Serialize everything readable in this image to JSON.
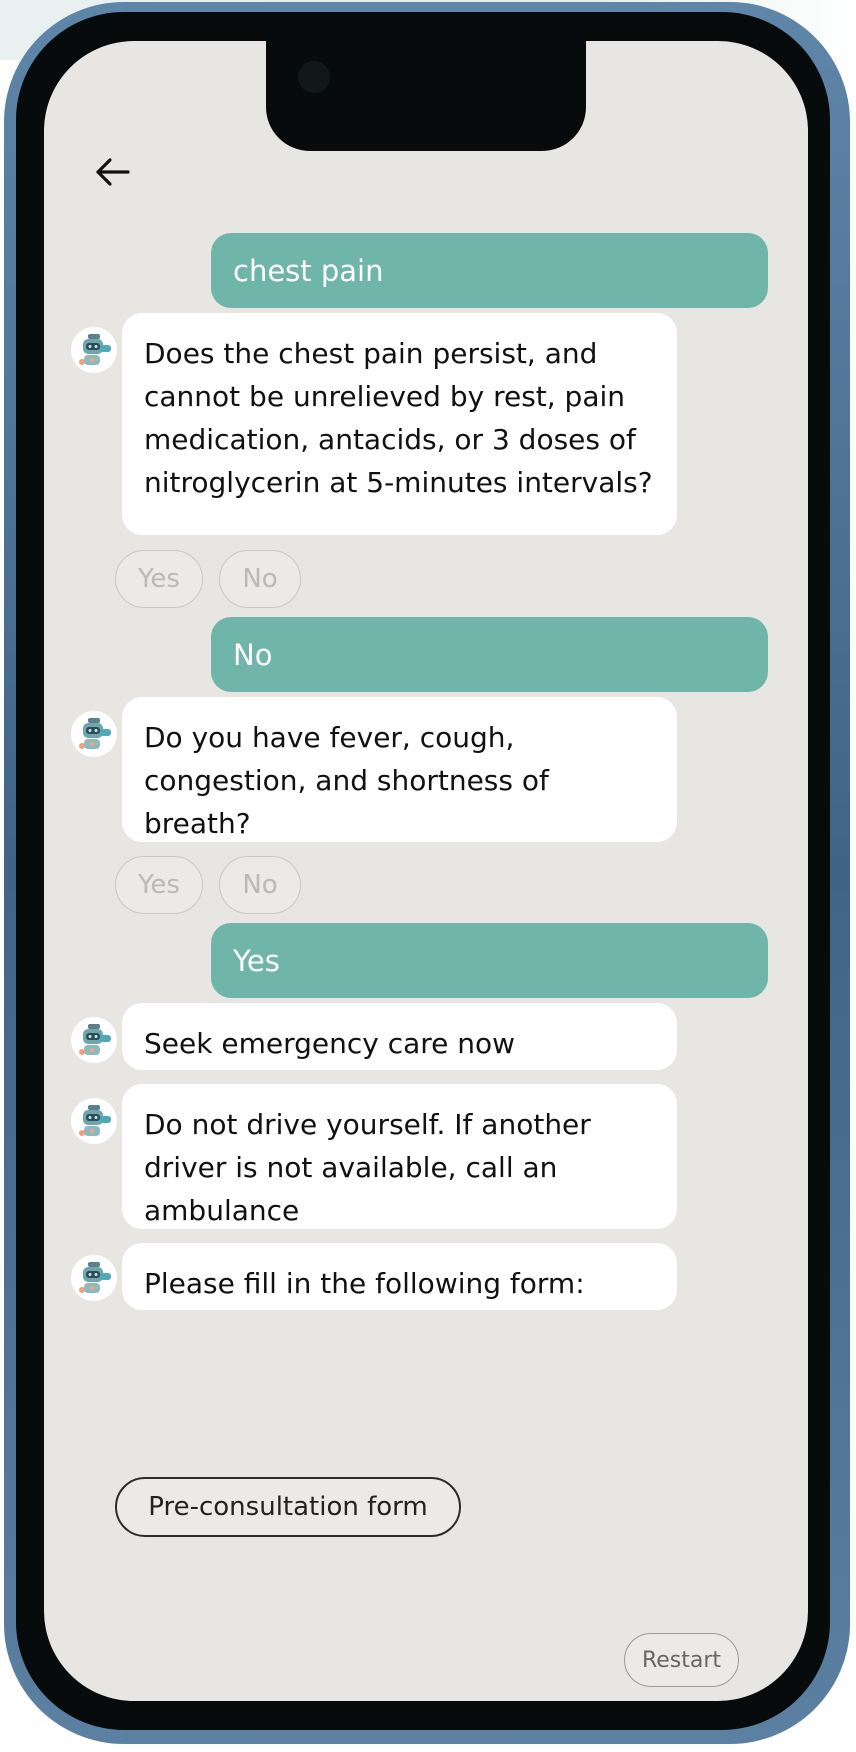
{
  "chat": {
    "messages": [
      {
        "role": "user",
        "text": "chest pain"
      },
      {
        "role": "bot",
        "text": "Does the chest pain persist, and cannot be unrelieved by rest, pain medication, antacids, or 3 doses of nitroglycerin at 5-minutes intervals?"
      },
      {
        "role": "user",
        "text": "No"
      },
      {
        "role": "bot",
        "text": "Do you have fever, cough, congestion, and shortness of breath?"
      },
      {
        "role": "user",
        "text": "Yes"
      },
      {
        "role": "bot",
        "text": "Seek emergency care now"
      },
      {
        "role": "bot",
        "text": "Do not drive yourself. If another driver is not available, call an ambulance"
      },
      {
        "role": "bot",
        "text": "Please fill in the following form:"
      }
    ],
    "quick_replies": {
      "yes": "Yes",
      "no": "No"
    },
    "form_button": "Pre-consultation form",
    "restart_button": "Restart"
  },
  "icons": {
    "back": "arrow-left-icon",
    "bot_avatar": "robot-doctor-icon"
  },
  "colors": {
    "user_bubble": "#6fb5a9",
    "screen_background": "#e8e6e3",
    "bot_bubble": "#ffffff",
    "frame": "#4a6f92"
  }
}
